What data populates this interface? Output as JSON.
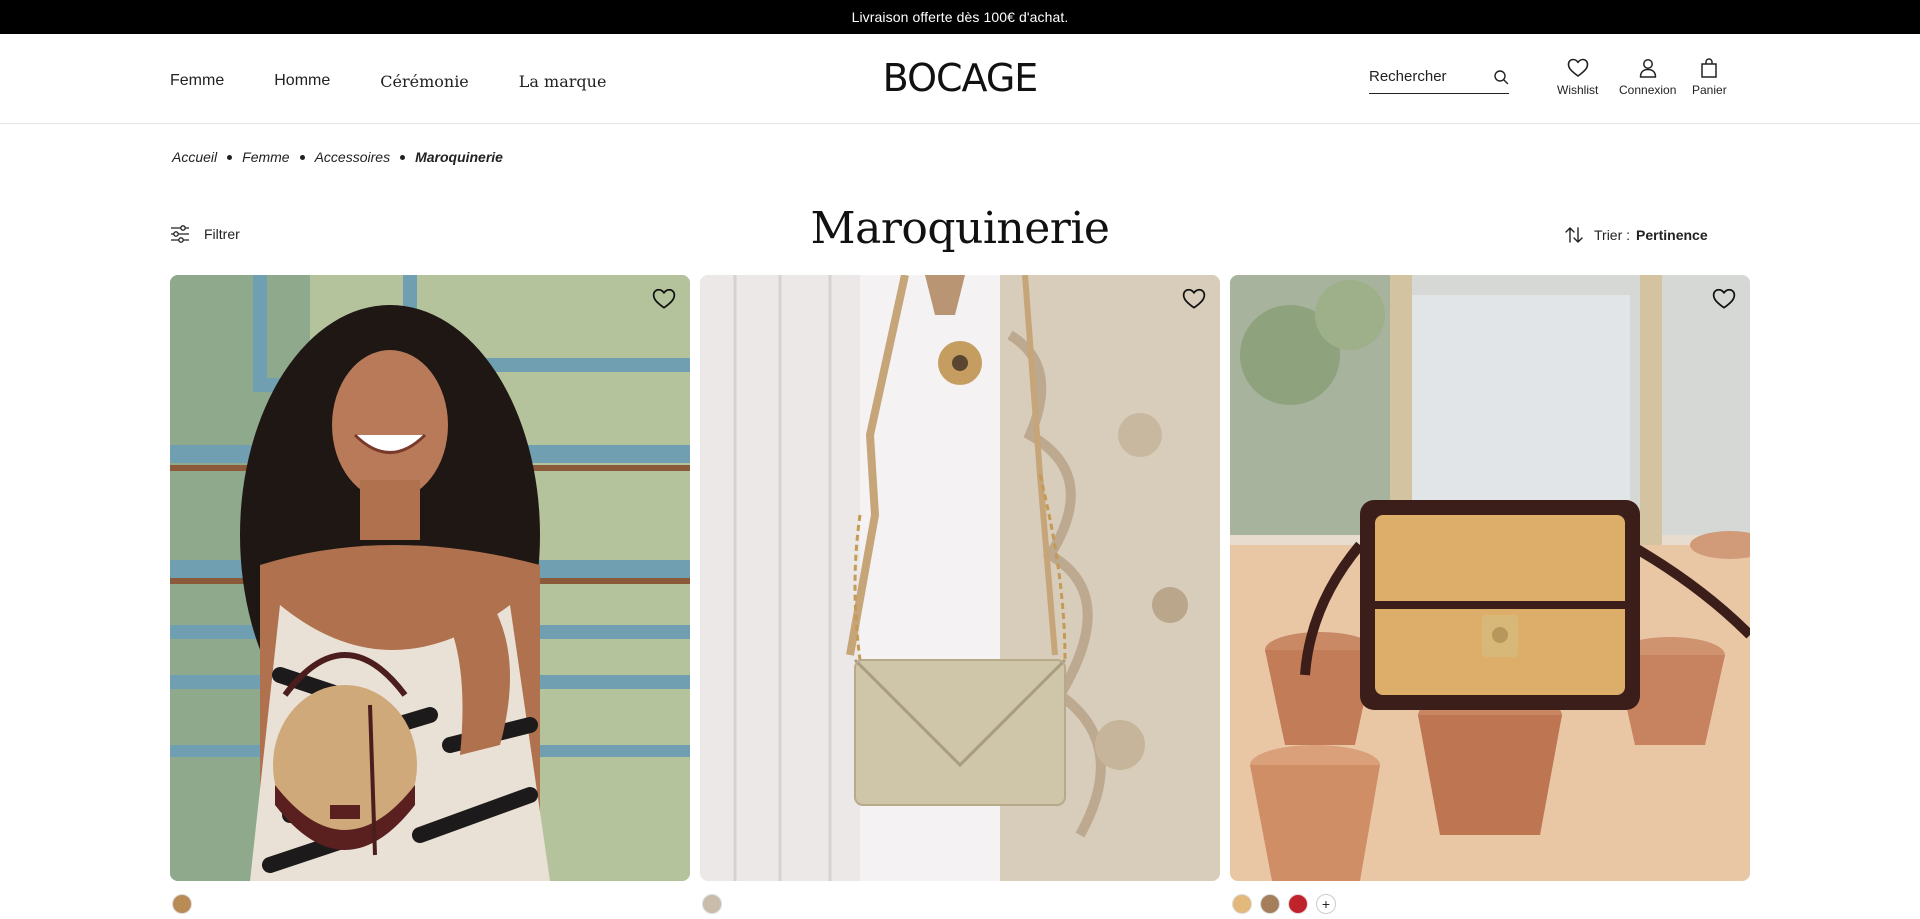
{
  "announcement": "Livraison offerte dès 100€ d'achat.",
  "nav": [
    "Femme",
    "Homme",
    "Cérémonie",
    "La marque"
  ],
  "logo": "BOCAGE",
  "search": {
    "placeholder": "Rechercher",
    "icon": "search-icon"
  },
  "header_actions": [
    {
      "label": "Wishlist",
      "icon": "heart-icon"
    },
    {
      "label": "Connexion",
      "icon": "user-icon"
    },
    {
      "label": "Panier",
      "icon": "bag-icon"
    }
  ],
  "breadcrumb": [
    "Accueil",
    "Femme",
    "Accessoires",
    "Maroquinerie"
  ],
  "page_title": "Maroquinerie",
  "filter_label": "Filtrer",
  "sort": {
    "label": "Trier :",
    "value": "Pertinence"
  },
  "products": [
    {
      "image": "model-with-straw-bucket-bag",
      "swatches": [
        "#b98b56"
      ],
      "more": false
    },
    {
      "image": "gold-leather-envelope-crossbody-bag",
      "swatches": [
        "#c9bcab"
      ],
      "more": false
    },
    {
      "image": "straw-and-leather-crossbody-bag-with-pots",
      "swatches": [
        "#e2b97a",
        "#a57e5c",
        "#c0232b"
      ],
      "more": true
    }
  ],
  "colors": {
    "topbar_bg": "#000000",
    "text": "#1b1b1b",
    "border": "#e6e6e6"
  }
}
